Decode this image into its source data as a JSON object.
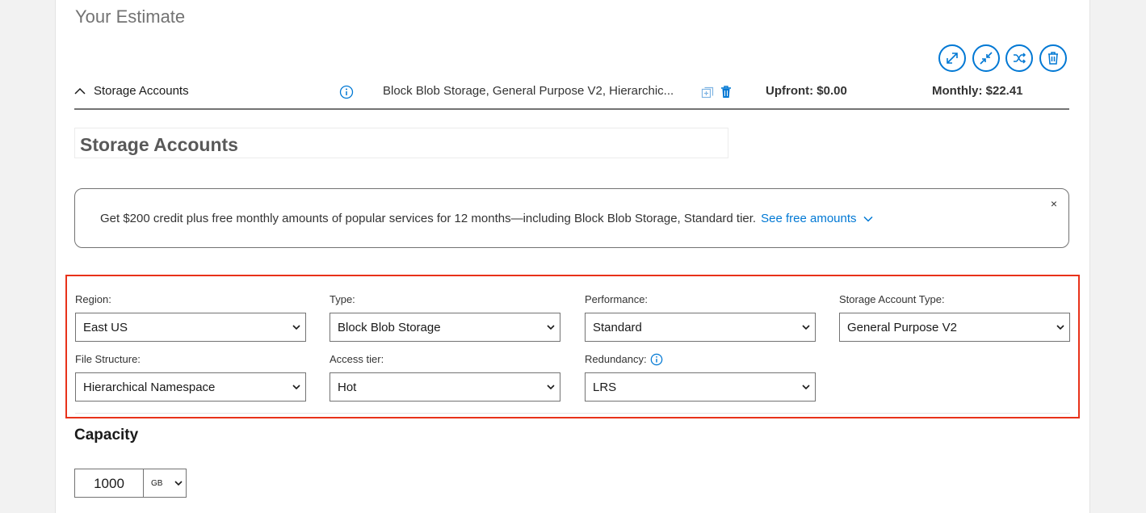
{
  "estimate": {
    "title": "Your Estimate"
  },
  "toolbar": {
    "icons": [
      "expand-all-icon",
      "collapse-all-icon",
      "shuffle-icon",
      "delete-all-icon"
    ]
  },
  "service": {
    "name": "Storage Accounts",
    "description": "Block Blob Storage, General Purpose V2, Hierarchic...",
    "upfront": "Upfront: $0.00",
    "monthly": "Monthly: $22.41"
  },
  "service_name_input": "Storage Accounts",
  "banner": {
    "text": "Get $200 credit plus free monthly amounts of popular services for 12 months—including Block Blob Storage, Standard tier.",
    "link": "See free amounts",
    "close": "×"
  },
  "config": {
    "region": {
      "label": "Region:",
      "value": "East US"
    },
    "type": {
      "label": "Type:",
      "value": "Block Blob Storage"
    },
    "performance": {
      "label": "Performance:",
      "value": "Standard"
    },
    "account_type": {
      "label": "Storage Account Type:",
      "value": "General Purpose V2"
    },
    "file_structure": {
      "label": "File Structure:",
      "value": "Hierarchical Namespace"
    },
    "access_tier": {
      "label": "Access tier:",
      "value": "Hot"
    },
    "redundancy": {
      "label": "Redundancy:",
      "value": "LRS"
    }
  },
  "capacity": {
    "title": "Capacity",
    "value": "1000",
    "unit": "GB"
  },
  "colors": {
    "accent": "#0078d4",
    "highlight": "#e8321a"
  }
}
